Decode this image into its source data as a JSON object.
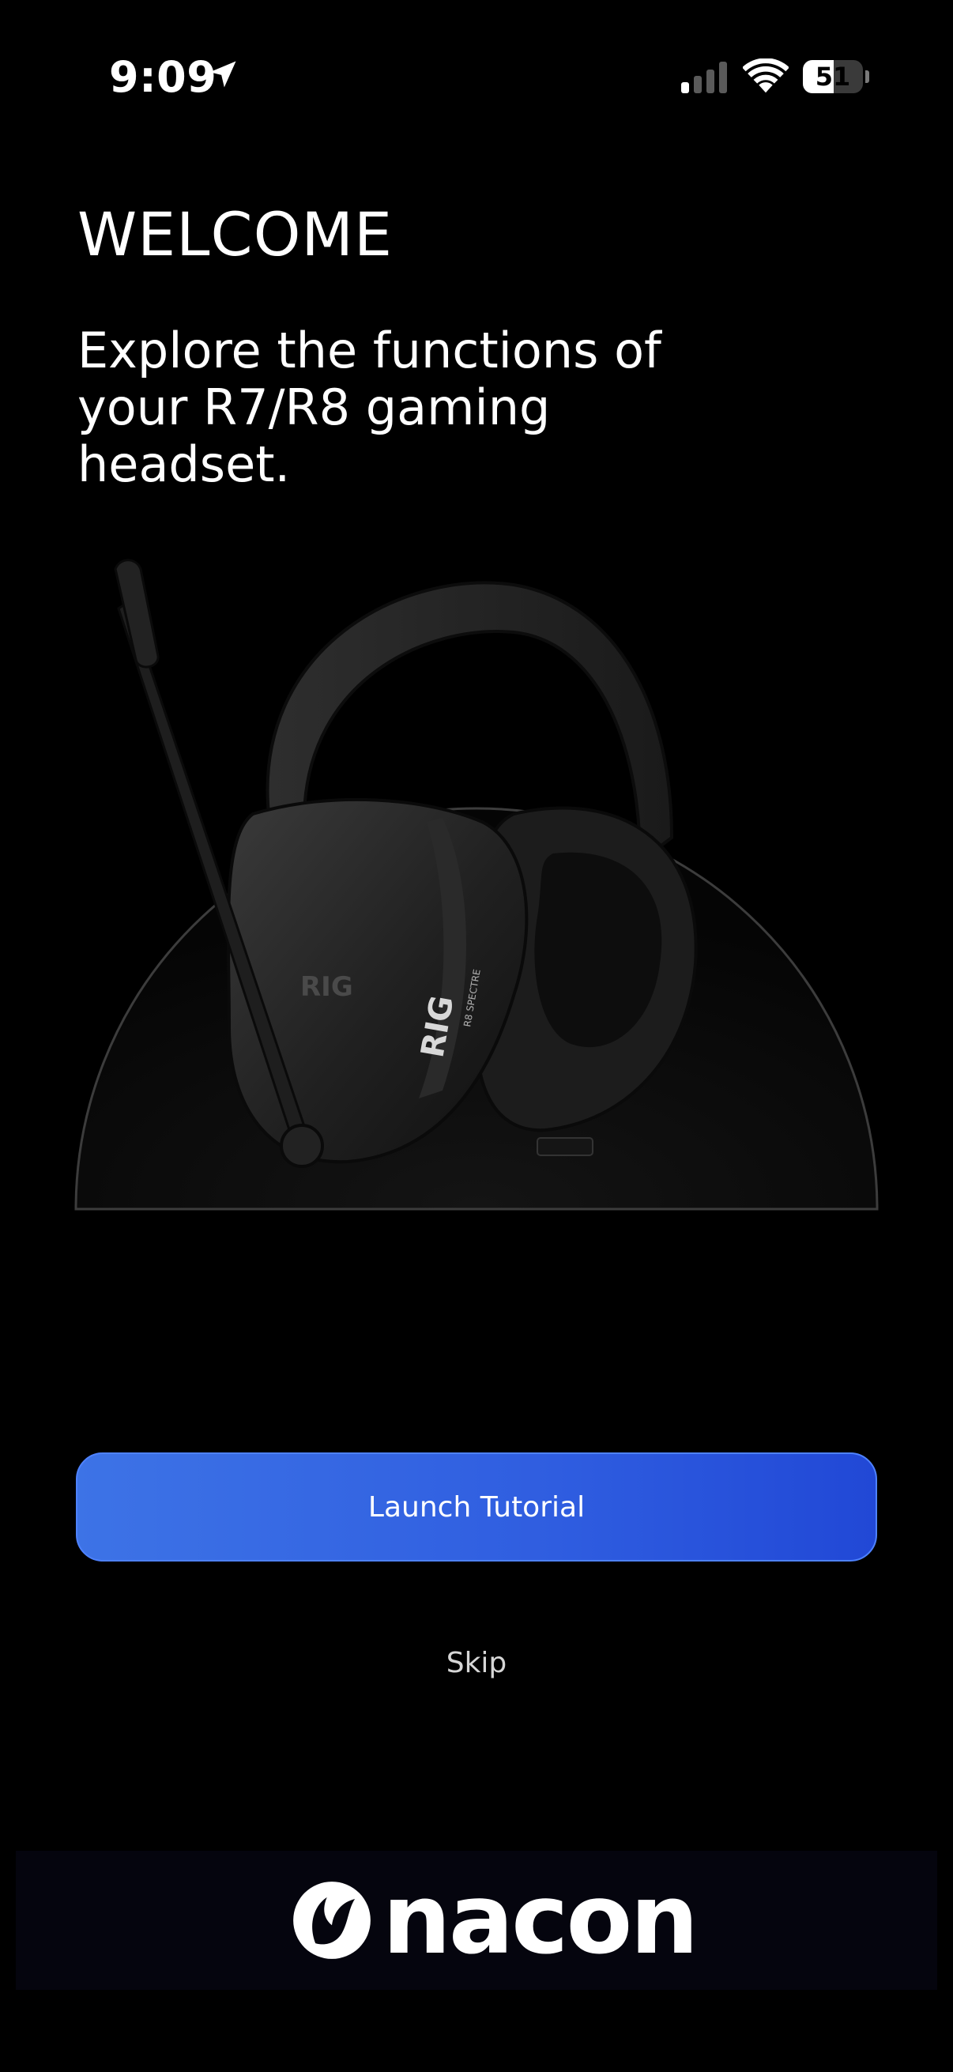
{
  "status_bar": {
    "time": "9:09",
    "battery_level": "51",
    "battery_fraction": 0.51
  },
  "welcome": {
    "title": "WELCOME",
    "subtitle": "Explore the functions of your R7/R8 gaming headset."
  },
  "hero": {
    "headset_brand": "RIG",
    "headset_model": "R8 SPECTRE"
  },
  "actions": {
    "launch_label": "Launch Tutorial",
    "skip_label": "Skip"
  },
  "footer": {
    "brand": "nacon"
  },
  "colors": {
    "background": "#000000",
    "button_start": "#3d73e6",
    "button_end": "#2148d6",
    "footer_bg": "#05050e"
  },
  "icons": [
    "location-arrow-icon",
    "cellular-signal-icon",
    "wifi-icon",
    "battery-icon",
    "nacon-logo-icon"
  ]
}
